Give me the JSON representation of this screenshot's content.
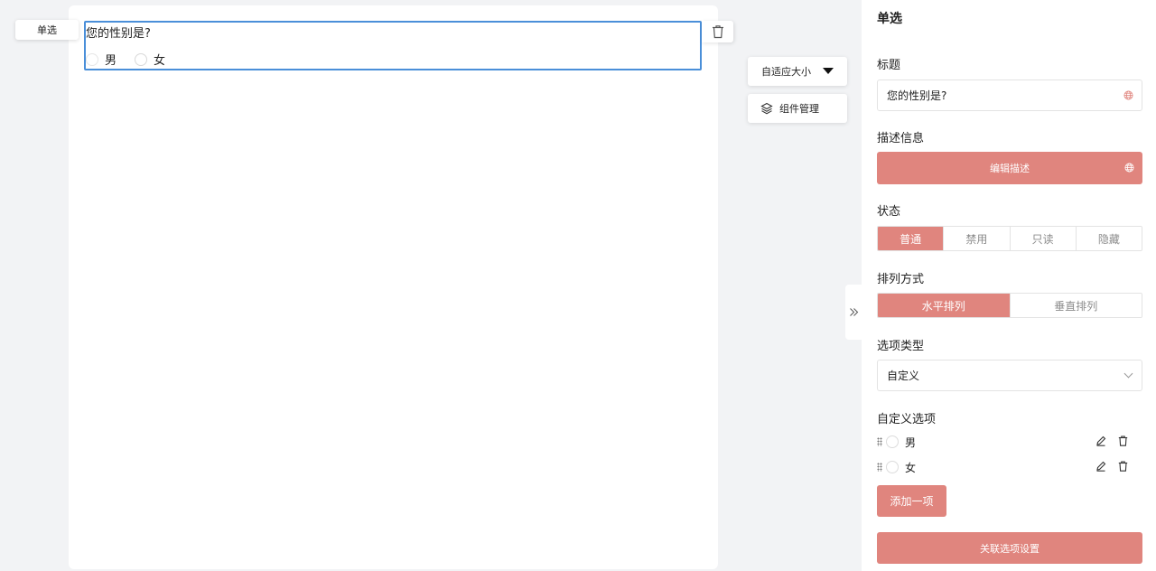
{
  "canvas": {
    "type_tag": "单选",
    "question": {
      "title": "您的性别是?",
      "options": [
        "男",
        "女"
      ]
    }
  },
  "tools": {
    "size_label": "自适应大小",
    "layers_label": "组件管理"
  },
  "panel": {
    "title": "单选",
    "title_section": {
      "label": "标题",
      "value": "您的性别是?"
    },
    "description": {
      "label": "描述信息",
      "button": "编辑描述"
    },
    "status": {
      "label": "状态",
      "options": [
        "普通",
        "禁用",
        "只读",
        "隐藏"
      ],
      "selected": "普通"
    },
    "layout": {
      "label": "排列方式",
      "options": [
        "水平排列",
        "垂直排列"
      ],
      "selected": "水平排列"
    },
    "option_type": {
      "label": "选项类型",
      "value": "自定义"
    },
    "custom_options": {
      "label": "自定义选项",
      "items": [
        "男",
        "女"
      ],
      "add_button": "添加一项"
    },
    "linked_button": "关联选项设置"
  },
  "colors": {
    "accent": "#e0857e",
    "selection_border": "#4a8fd9"
  },
  "icons": {
    "delete": "trash-icon",
    "size_caret": "caret-down-icon",
    "layers": "layers-icon",
    "collapse": "double-chevron-right-icon",
    "language": "globe-icon",
    "edit": "pencil-icon",
    "drag": "drag-handle-icon",
    "select": "chevron-down-icon"
  }
}
